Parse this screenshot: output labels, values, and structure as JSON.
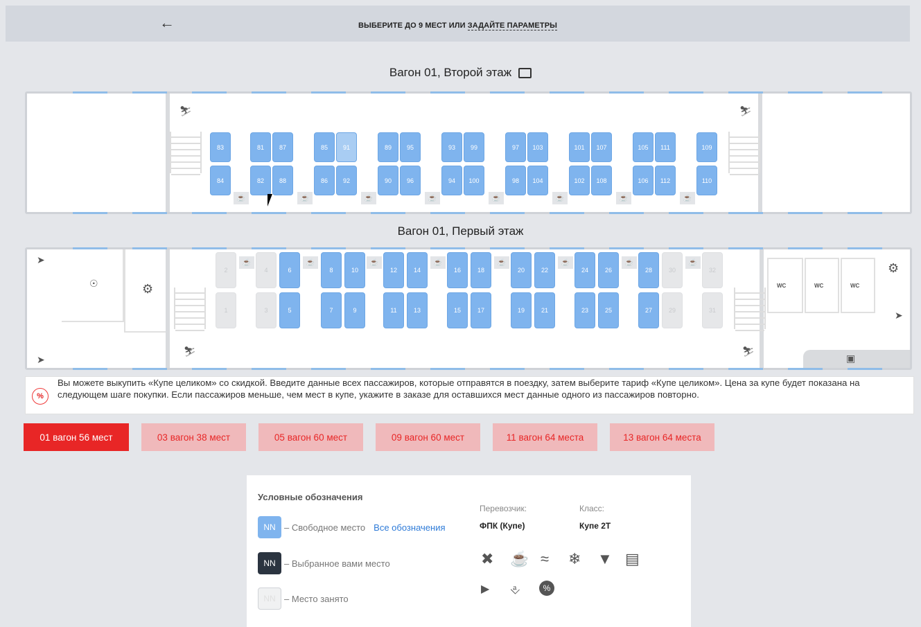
{
  "topbar": {
    "back_icon": "arrow-left-icon",
    "title_prefix": "ВЫБЕРИТЕ ДО 9 МЕСТ  ИЛИ ",
    "title_link": "ЗАДАЙТЕ ПАРАМЕТРЫ"
  },
  "decks": {
    "upper_title": "Вагон 01,  Второй этаж",
    "lower_title": "Вагон 01,  Первый этаж",
    "upper_top": [
      "83",
      "81",
      "87",
      "85",
      "91",
      "89",
      "95",
      "93",
      "99",
      "97",
      "103",
      "101",
      "107",
      "105",
      "111",
      "109"
    ],
    "upper_bottom": [
      "84",
      "82",
      "88",
      "86",
      "92",
      "90",
      "96",
      "94",
      "100",
      "98",
      "104",
      "102",
      "108",
      "106",
      "112",
      "110"
    ],
    "lower_top": [
      "2",
      "4",
      "6",
      "8",
      "10",
      "12",
      "14",
      "16",
      "18",
      "20",
      "22",
      "24",
      "26",
      "28",
      "30",
      "32"
    ],
    "lower_bottom": [
      "1",
      "3",
      "5",
      "7",
      "9",
      "11",
      "13",
      "15",
      "17",
      "19",
      "21",
      "23",
      "25",
      "27",
      "29",
      "31"
    ],
    "busy_seats": [
      "1",
      "2",
      "3",
      "4",
      "29",
      "30",
      "31",
      "32"
    ],
    "wc_labels": [
      "WC",
      "WC",
      "WC"
    ],
    "table_icon": "coffee-icon"
  },
  "info": {
    "icon": "percent-icon",
    "text": "Вы можете выкупить «Купе целиком» со скидкой. Введите данные всех пассажиров, которые отправятся в поездку, затем выберите тариф «Купе целиком». Цена за купе будет показана на следующем шаге покупки. Если пассажиров меньше, чем мест в купе, укажите в заказе для оставшихся мест данные одного из пассажиров повторно."
  },
  "cars": [
    {
      "label": "01 вагон 56 мест",
      "active": true
    },
    {
      "label": "03 вагон 38 мест",
      "active": false
    },
    {
      "label": "05 вагон 60 мест",
      "active": false
    },
    {
      "label": "09 вагон 60 мест",
      "active": false
    },
    {
      "label": "11 вагон 64 места",
      "active": false
    },
    {
      "label": "13 вагон 64 места",
      "active": false
    }
  ],
  "legend": {
    "title": "Условные обозначения",
    "chip": "NN",
    "free": "– Свободное место",
    "all_link": "Все обозначения",
    "selected": "– Выбранное вами место",
    "busy": "– Место занято",
    "carrier_label": "Перевозчик:",
    "carrier_value": "ФПК (Купе)",
    "class_label": "Класс:",
    "class_value": "Купе 2Т",
    "amenities": [
      "food-icon",
      "coffee-icon",
      "wifi-icon",
      "air-conditioning-icon",
      "toilet-icon",
      "press-icon",
      "media-icon",
      "linen-icon",
      "discount-icon"
    ]
  }
}
